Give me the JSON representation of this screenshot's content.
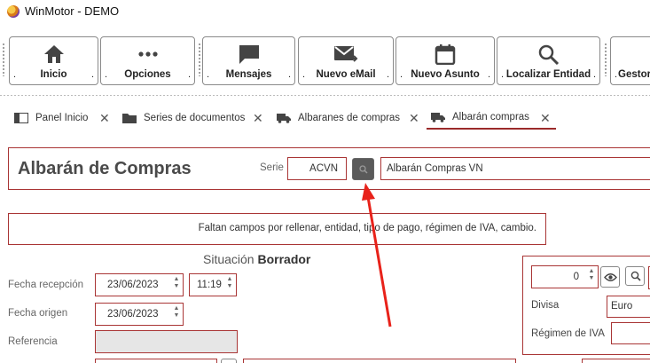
{
  "window": {
    "title": "WinMotor - DEMO"
  },
  "toolbar": {
    "buttons": [
      {
        "label": "Inicio",
        "icon": "home-icon"
      },
      {
        "label": "Opciones",
        "icon": "more-dots-icon"
      },
      {
        "label": "Mensajes",
        "icon": "message-icon"
      },
      {
        "label": "Nuevo eMail",
        "icon": "email-icon"
      },
      {
        "label": "Nuevo Asunto",
        "icon": "calendar-icon"
      },
      {
        "label": "Localizar Entidad",
        "icon": "search-icon"
      },
      {
        "label": "Gestor",
        "icon": "gestor-icon"
      }
    ],
    "dot": "."
  },
  "tabs": [
    {
      "label": "Panel Inicio",
      "icon": "dashboard-icon"
    },
    {
      "label": "Series de documentos",
      "icon": "folder-icon"
    },
    {
      "label": "Albaranes de compras",
      "icon": "truck-icon"
    },
    {
      "label": "Albarán compras",
      "icon": "truck-icon"
    }
  ],
  "tab_close": "✕",
  "form": {
    "title": "Albarán de Compras",
    "serie_label": "Serie",
    "serie_value": "ACVN",
    "serie_desc": "Albarán Compras VN",
    "message": "Faltan campos por rellenar, entidad, tipo de pago, régimen de IVA, cambio.",
    "status_prefix": "Situación",
    "status_value": "Borrador",
    "fecha_recepcion_label": "Fecha recepción",
    "fecha_recepcion_value": "23/06/2023",
    "hora_value": "11:19",
    "fecha_origen_label": "Fecha origen",
    "fecha_origen_value": "23/06/2023",
    "referencia_label": "Referencia",
    "referencia_value": "",
    "numero_value": "0",
    "divisa_label": "Divisa",
    "divisa_value": "Euro",
    "regimen_label": "Régimen de IVA",
    "regimen_value": ""
  },
  "colors": {
    "accent": "#a93535",
    "annotation_arrow": "#e8221a"
  }
}
